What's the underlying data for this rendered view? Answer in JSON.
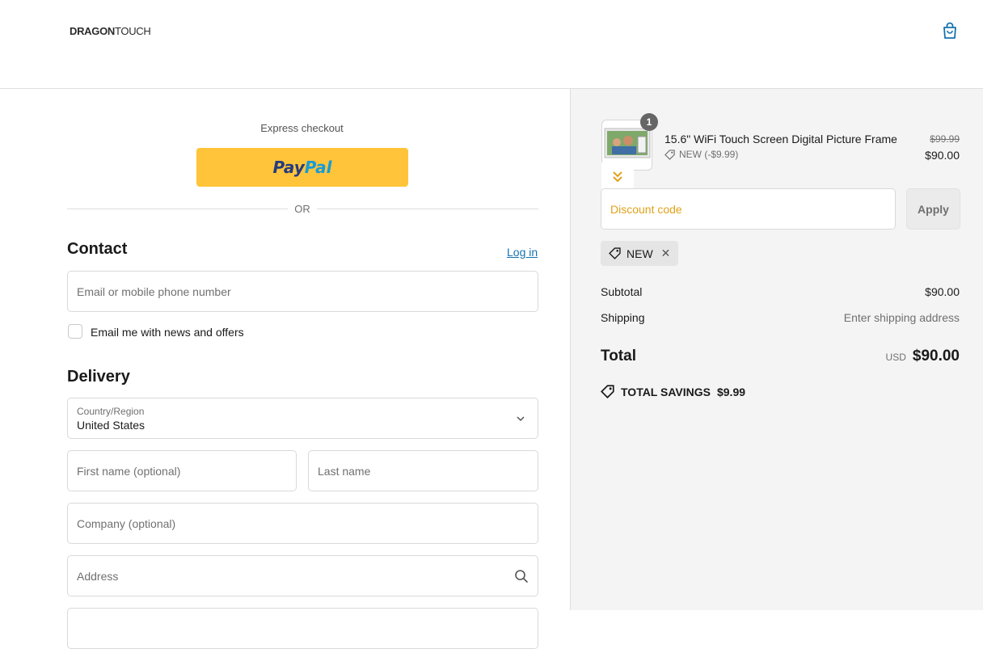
{
  "header": {
    "logo_main": "DRAGON",
    "logo_thin": "TOUCH"
  },
  "express": {
    "label": "Express checkout",
    "paypal_pay": "Pay",
    "paypal_pal": "Pal",
    "or_label": "OR"
  },
  "contact": {
    "title": "Contact",
    "login_link": "Log in",
    "email_placeholder": "Email or mobile phone number",
    "newsletter_label": "Email me with news and offers"
  },
  "delivery": {
    "title": "Delivery",
    "country_label": "Country/Region",
    "country_value": "United States",
    "first_name_placeholder": "First name (optional)",
    "last_name_placeholder": "Last name",
    "company_placeholder": "Company (optional)",
    "address_placeholder": "Address"
  },
  "summary": {
    "item": {
      "quantity": "1",
      "name": "15.6\" WiFi Touch Screen Digital Picture Frame",
      "discount_text": "NEW (-$9.99)",
      "original_price": "$99.99",
      "price": "$90.00"
    },
    "discount_placeholder": "Discount code",
    "apply_label": "Apply",
    "applied_code": "NEW",
    "subtotal_label": "Subtotal",
    "subtotal_value": "$90.00",
    "shipping_label": "Shipping",
    "shipping_value": "Enter shipping address",
    "total_label": "Total",
    "currency": "USD",
    "total_value": "$90.00",
    "savings_label": "TOTAL SAVINGS",
    "savings_value": "$9.99"
  },
  "colors": {
    "paypal_yellow": "#ffc439",
    "link_blue": "#1773b0",
    "discount_placeholder": "#e0a21a"
  }
}
